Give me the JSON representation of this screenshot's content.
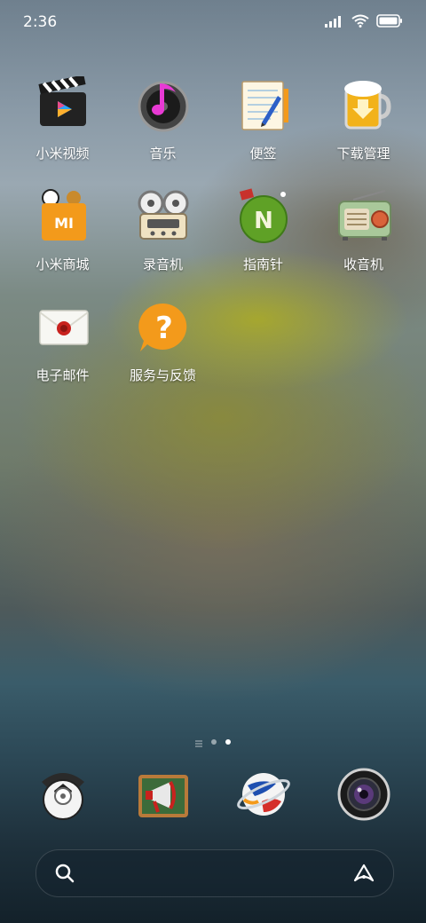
{
  "status_bar": {
    "time": "2:36",
    "icons": [
      "signal-icon",
      "wifi-icon",
      "battery-icon"
    ]
  },
  "apps": [
    {
      "label": "小米视频",
      "icon": "video-clapper-icon"
    },
    {
      "label": "音乐",
      "icon": "music-disc-icon"
    },
    {
      "label": "便签",
      "icon": "notepad-icon"
    },
    {
      "label": "下载管理",
      "icon": "beer-mug-icon"
    },
    {
      "label": "小米商城",
      "icon": "shopping-bag-icon"
    },
    {
      "label": "录音机",
      "icon": "tape-recorder-icon"
    },
    {
      "label": "指南针",
      "icon": "compass-globe-icon"
    },
    {
      "label": "收音机",
      "icon": "radio-icon"
    },
    {
      "label": "电子邮件",
      "icon": "envelope-icon"
    },
    {
      "label": "服务与反馈",
      "icon": "help-bubble-icon"
    }
  ],
  "page_indicator": {
    "pages": 3,
    "active_index": 2
  },
  "dock": [
    {
      "icon": "phone-icon"
    },
    {
      "icon": "messages-megaphone-icon"
    },
    {
      "icon": "browser-planet-icon"
    },
    {
      "icon": "camera-lens-icon"
    }
  ],
  "search_bar": {
    "left_icon": "search-icon",
    "right_icon": "assistant-icon"
  },
  "colors": {
    "accent_orange": "#f39a1b",
    "music_pink": "#e83ad4",
    "compass_green": "#5fa126"
  }
}
